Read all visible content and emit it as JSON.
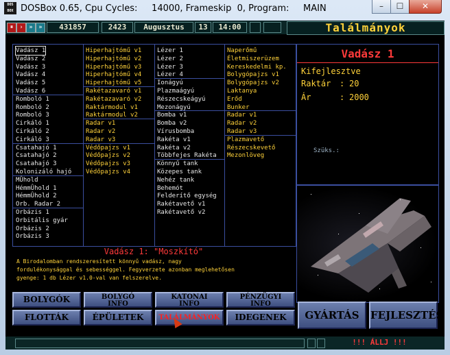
{
  "window": {
    "title": "DOSBox 0.65, Cpu Cycles:     14000, Frameskip  0, Program:     MAIN",
    "icon_text": "DOS BOX",
    "controls": {
      "minimize": "–",
      "maximize": "☐",
      "close": "✕"
    }
  },
  "topbar": {
    "buttons": [
      "⏸",
      "›",
      "»",
      "»"
    ],
    "money": "431857",
    "number": "2423",
    "month": "Augusztus",
    "day": "13",
    "time": "14:00",
    "screen_title": "Találmányok"
  },
  "columns": [
    {
      "groups": [
        [
          "Vadász 1",
          "Vadász 2",
          "Vadász 3",
          "Vadász 4",
          "Vadász 5",
          "Vadász 6"
        ],
        [
          "Romboló 1",
          "Romboló 2",
          "Romboló 3",
          "Cirkáló 1",
          "Cirkáló 2",
          "Cirkáló 3"
        ],
        [
          "Csatahajó 1",
          "Csatahajó 2",
          "Csatahajó 3",
          "Kolonizáló hajó"
        ],
        [
          "MÛhold",
          "HémmÛhold 1",
          "HémmÛhold 2",
          "Orb. Radar 2"
        ],
        [
          "Orbázis 1",
          "Orbitális gyár",
          "Orbázis 2",
          "Orbázis 3"
        ]
      ]
    },
    {
      "groups": [
        [
          "Hiperhajtómű v1",
          "Hiperhajtómű v2",
          "Hiperhajtómű v3",
          "Hiperhajtómű v4",
          "Hiperhajtómű v5"
        ],
        [
          "Rakétazavaró v1",
          "Rakétazavaró v2",
          "Raktármodul v1",
          "Raktármodul v2"
        ],
        [
          "Radar v1",
          "Radar v2",
          "Radar v3"
        ],
        [
          "Védőpajzs v1",
          "Védőpajzs v2",
          "Védőpajzs v3",
          "Védőpajzs v4"
        ]
      ]
    },
    {
      "groups": [
        [
          "Lézer 1",
          "Lézer 2",
          "Lézer 3",
          "Lézer 4"
        ],
        [
          "Ionágyú",
          "Plazmaágyú",
          "Részecskeágyú",
          "Mezonágyú"
        ],
        [
          "Bomba v1",
          "Bomba v2",
          "Vírusbomba",
          "Rakéta v1",
          "Rakéta v2",
          "Többfejes Rakéta"
        ],
        [
          "Könnyű tank",
          "Közepes tank",
          "Nehéz tank",
          "Behemót",
          "Felderítő egység",
          "Rakétavető v1",
          "Rakétavető v2"
        ]
      ]
    },
    {
      "groups": [
        [
          "Naperőmű",
          "Életmiszerüzem",
          "Kereskedelmi kp.",
          "Bolygópajzs v1",
          "Bolygópajzs v2",
          "Laktanya",
          "Erőd",
          "Bunker"
        ],
        [
          "Radar v1",
          "Radar v2",
          "Radar v3"
        ],
        [
          "Plazmavető",
          "Részecskevető",
          "Mezonlöveg"
        ]
      ]
    }
  ],
  "selected_item": "Vadász 1",
  "info": {
    "title": "Vadász 1",
    "line1": "Kifejlesztve",
    "stock_label": "Raktár",
    "stock_value": "20",
    "price_label": "Ár",
    "price_value": "2000",
    "needs_label": "Szüks.:"
  },
  "description": {
    "title": "Vadász 1: \"Moszkító\"",
    "text": "A Birodalomban rendszeresített könnyű vadász, nagy\nfordulékonysággal és sebességgel. Fegyverzete azonban meglehetősen\ngyenge: 1 db Lézer v1.0-val van felszerelve."
  },
  "nav": {
    "bolygok": "BOLYGÓK",
    "bolygo_info_1": "BOLYGÓ",
    "bolygo_info_2": "INFO",
    "katonai_info_1": "KATONAI",
    "katonai_info_2": "INFO",
    "penzugyi_info_1": "PÉNZÜGYI",
    "penzugyi_info_2": "INFO",
    "flottak": "FLOTTÁK",
    "epuletek": "ÉPÜLETEK",
    "talalmanyok": "TALÁLMÁNYOK",
    "idegenek": "IDEGENEK",
    "gyartas": "GYÁRTÁS",
    "fejlesztes": "FEJLESZTÉS"
  },
  "status": "!!! ÁLLJ !!!",
  "colors": {
    "accent_yellow": "#ffd23a",
    "accent_red": "#ff3a3a",
    "panel_border": "#3b4fa0"
  }
}
